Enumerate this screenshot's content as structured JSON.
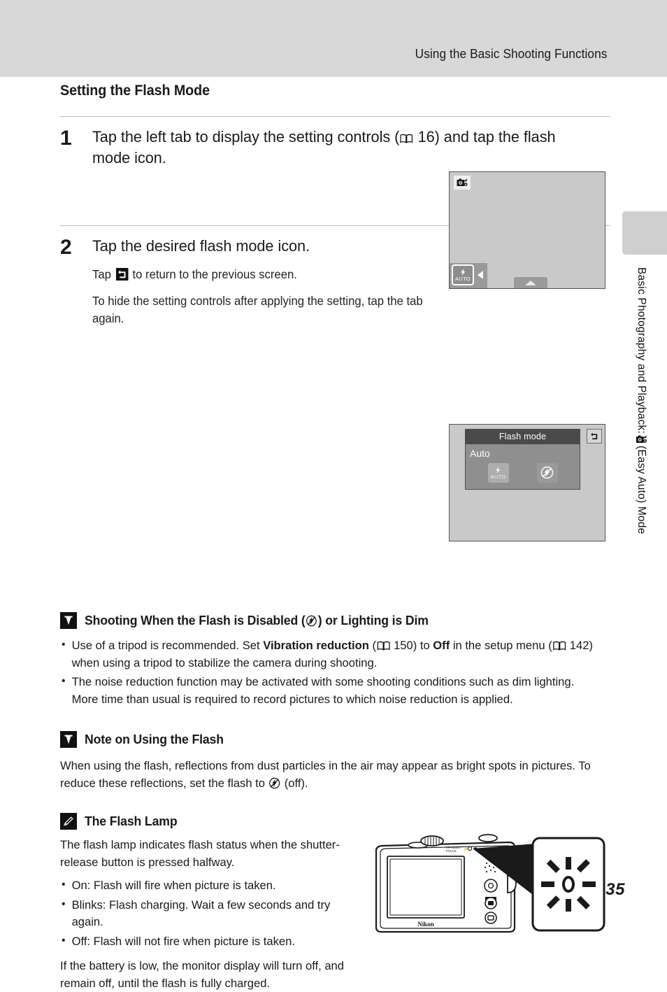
{
  "header": {
    "running_title": "Using the Basic Shooting Functions"
  },
  "side_tab": {
    "text_before": "Basic Photography and Playback: ",
    "icon": "easy-auto-camera-icon",
    "text_after": " (Easy Auto) Mode"
  },
  "section": {
    "title": "Setting the Flash Mode"
  },
  "steps": [
    {
      "number": "1",
      "heading_part1": "Tap the left tab to display the setting controls (",
      "ref_icon": "book-reference-icon",
      "ref_page": " 16) and tap the flash mode icon.",
      "screen": {
        "mode_icon": "easy-auto-camera-icon",
        "flash_button_label": "AUTO",
        "flash_button_icon": "flash-bolt-icon",
        "left_arrow_icon": "triangle-left-icon",
        "bottom_tab_icon": "triangle-up-icon"
      }
    },
    {
      "number": "2",
      "heading": "Tap the desired flash mode icon.",
      "sub1_before": "Tap ",
      "sub1_icon": "return-arrow-icon",
      "sub1_after": " to return to the previous screen.",
      "sub2": "To hide the setting controls after applying the setting, tap the tab again.",
      "screen": {
        "menu_title": "Flash mode",
        "menu_value": "Auto",
        "option1_label": "AUTO",
        "option1_icon": "flash-auto-icon",
        "option2_icon": "flash-off-icon",
        "return_icon": "return-arrow-icon"
      }
    }
  ],
  "notes": [
    {
      "badge": "caution-v-icon",
      "title_before": "Shooting When the Flash is Disabled (",
      "title_icon": "flash-off-icon",
      "title_after": ") or Lighting is Dim",
      "bullets": [
        {
          "seg1": "Use of a tripod is recommended. Set ",
          "bold1": "Vibration reduction",
          "seg2": " (",
          "icon1": "book-reference-icon",
          "seg3": " 150) to ",
          "bold2": "Off",
          "seg4": " in the setup menu (",
          "icon2": "book-reference-icon",
          "seg5": " 142) when using a tripod to stabilize the camera during shooting."
        },
        {
          "seg1": "The noise reduction function may be activated with some shooting conditions such as dim lighting. More time than usual is required to record pictures to which noise reduction is applied."
        }
      ]
    },
    {
      "badge": "caution-v-icon",
      "title": "Note on Using the Flash",
      "paragraph_before": "When using the flash, reflections from dust particles in the air may appear as bright spots in pictures. To reduce these reflections, set the flash to ",
      "paragraph_icon": "flash-off-icon",
      "paragraph_after": " (off)."
    },
    {
      "badge": "pencil-note-icon",
      "title": "The Flash Lamp",
      "intro": "The flash lamp indicates flash status when the shutter-release button is pressed halfway.",
      "bullets": [
        "On: Flash will fire when picture is taken.",
        "Blinks: Flash charging. Wait a few seconds and try again.",
        "Off: Flash will not fire when picture is taken."
      ],
      "outro": "If the battery is low, the monitor display will turn off, and remain off, until the flash is fully charged.",
      "illustration": {
        "camera_brand": "Nikon",
        "lamp_label": "flash-lamp-blinking-icon",
        "marking": "AF-ASSIST / FOCUS"
      }
    }
  ],
  "footer": {
    "page_number": "35"
  }
}
